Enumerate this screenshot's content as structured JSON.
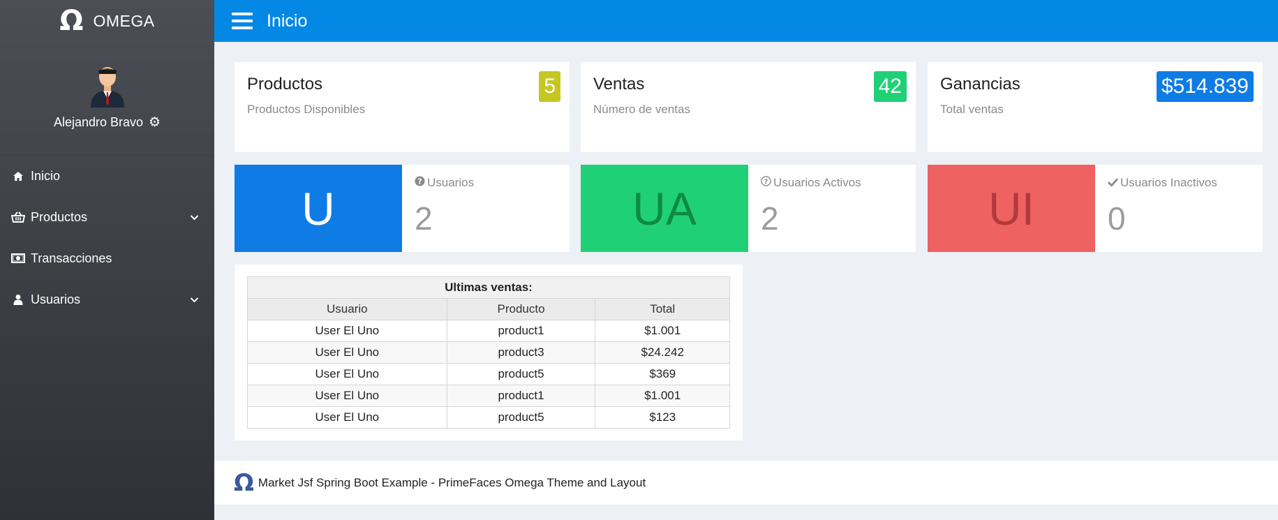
{
  "app": {
    "logo_glyph": "Ω",
    "name": "OMEGA"
  },
  "profile": {
    "name": "Alejandro Bravo",
    "settings_icon": "gear-icon"
  },
  "sidebar": {
    "items": [
      {
        "label": "Inicio",
        "icon": "home-icon",
        "has_submenu": false
      },
      {
        "label": "Productos",
        "icon": "basket-icon",
        "has_submenu": true
      },
      {
        "label": "Transacciones",
        "icon": "money-icon",
        "has_submenu": false
      },
      {
        "label": "Usuarios",
        "icon": "user-icon",
        "has_submenu": true
      }
    ]
  },
  "topbar": {
    "title": "Inicio",
    "menu_icon": "hamburger-icon"
  },
  "stats": [
    {
      "title": "Productos",
      "subtitle": "Productos Disponibles",
      "badge": "5",
      "badge_color": "#c6c622"
    },
    {
      "title": "Ventas",
      "subtitle": "Número de ventas",
      "badge": "42",
      "badge_color": "#20d077"
    },
    {
      "title": "Ganancias",
      "subtitle": "Total ventas",
      "badge": "$514.839",
      "badge_color": "#0f7be5"
    }
  ],
  "user_stats": [
    {
      "abbr": "U",
      "label": "Usuarios",
      "count": "2",
      "icon": "question-circle-icon",
      "box_color": "#0f7be5",
      "text_color": "#ffffff"
    },
    {
      "abbr": "UA",
      "label": "Usuarios Activos",
      "count": "2",
      "icon": "question-circle-icon",
      "box_color": "#20d077",
      "text_color": "#0e8a45"
    },
    {
      "abbr": "UI",
      "label": "Usuarios Inactivos",
      "count": "0",
      "icon": "check-icon",
      "box_color": "#ef6262",
      "text_color": "#b33a3a"
    }
  ],
  "sales_table": {
    "caption": "Ultimas ventas:",
    "columns": [
      "Usuario",
      "Producto",
      "Total"
    ],
    "rows": [
      [
        "User El Uno",
        "product1",
        "$1.001"
      ],
      [
        "User El Uno",
        "product3",
        "$24.242"
      ],
      [
        "User El Uno",
        "product5",
        "$369"
      ],
      [
        "User El Uno",
        "product1",
        "$1.001"
      ],
      [
        "User El Uno",
        "product5",
        "$123"
      ]
    ]
  },
  "footer": {
    "logo_glyph": "Ω",
    "text": "Market Jsf Spring Boot Example - PrimeFaces Omega Theme and Layout"
  }
}
